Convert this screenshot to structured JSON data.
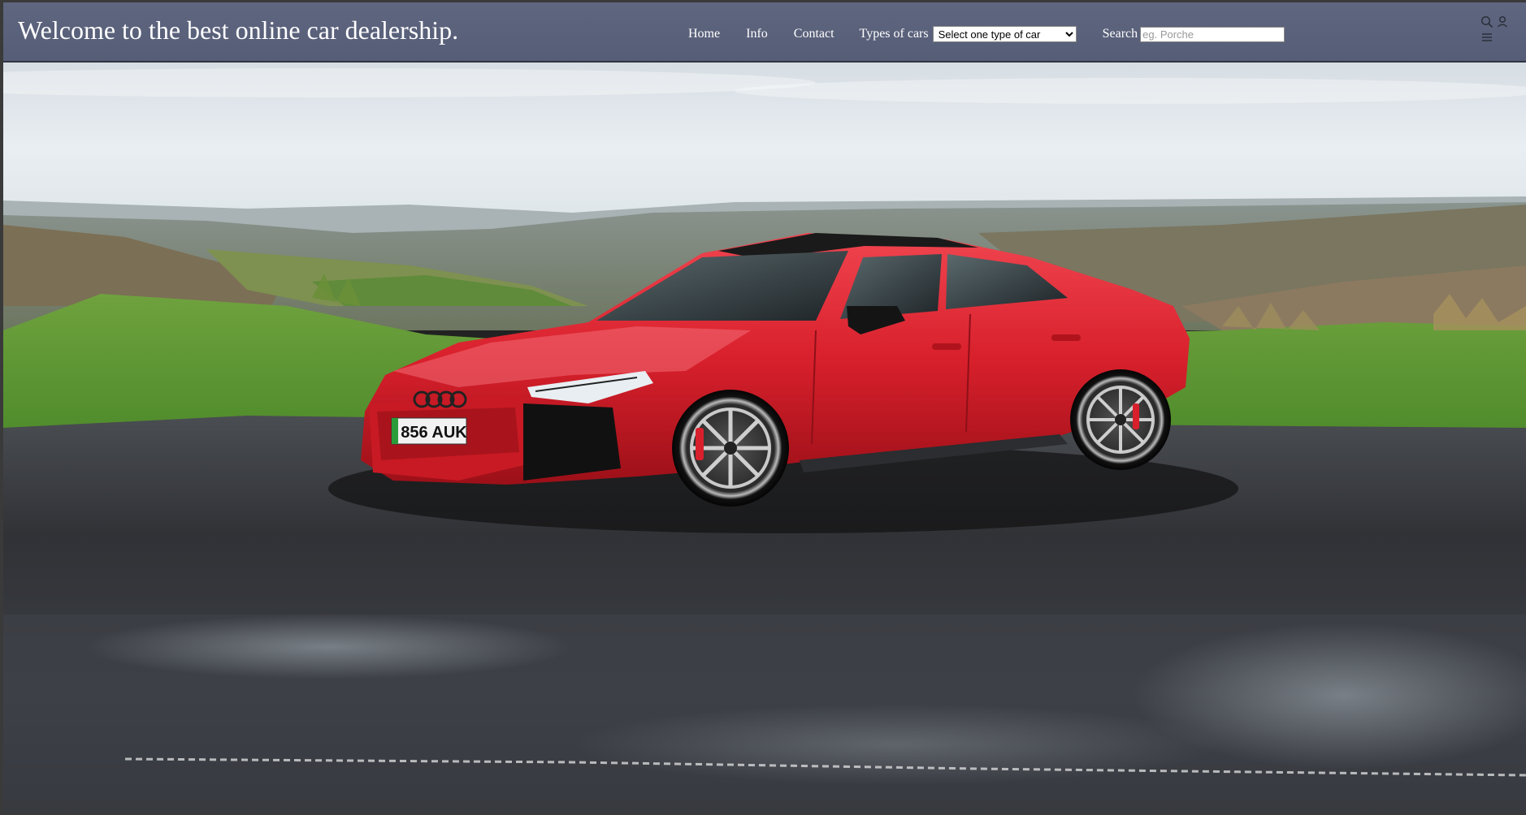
{
  "header": {
    "title": "Welcome to the best online car dealership.",
    "nav": {
      "home": "Home",
      "info": "Info",
      "contact": "Contact"
    },
    "types": {
      "label": "Types of cars",
      "selected": "Select one type of car"
    },
    "search": {
      "label": "Search",
      "placeholder": "eg. Porche"
    },
    "icons": [
      "search-icon",
      "user-icon",
      "menu-icon"
    ]
  },
  "hero": {
    "plate": "856 AUK",
    "car_color": "#d8202c"
  }
}
